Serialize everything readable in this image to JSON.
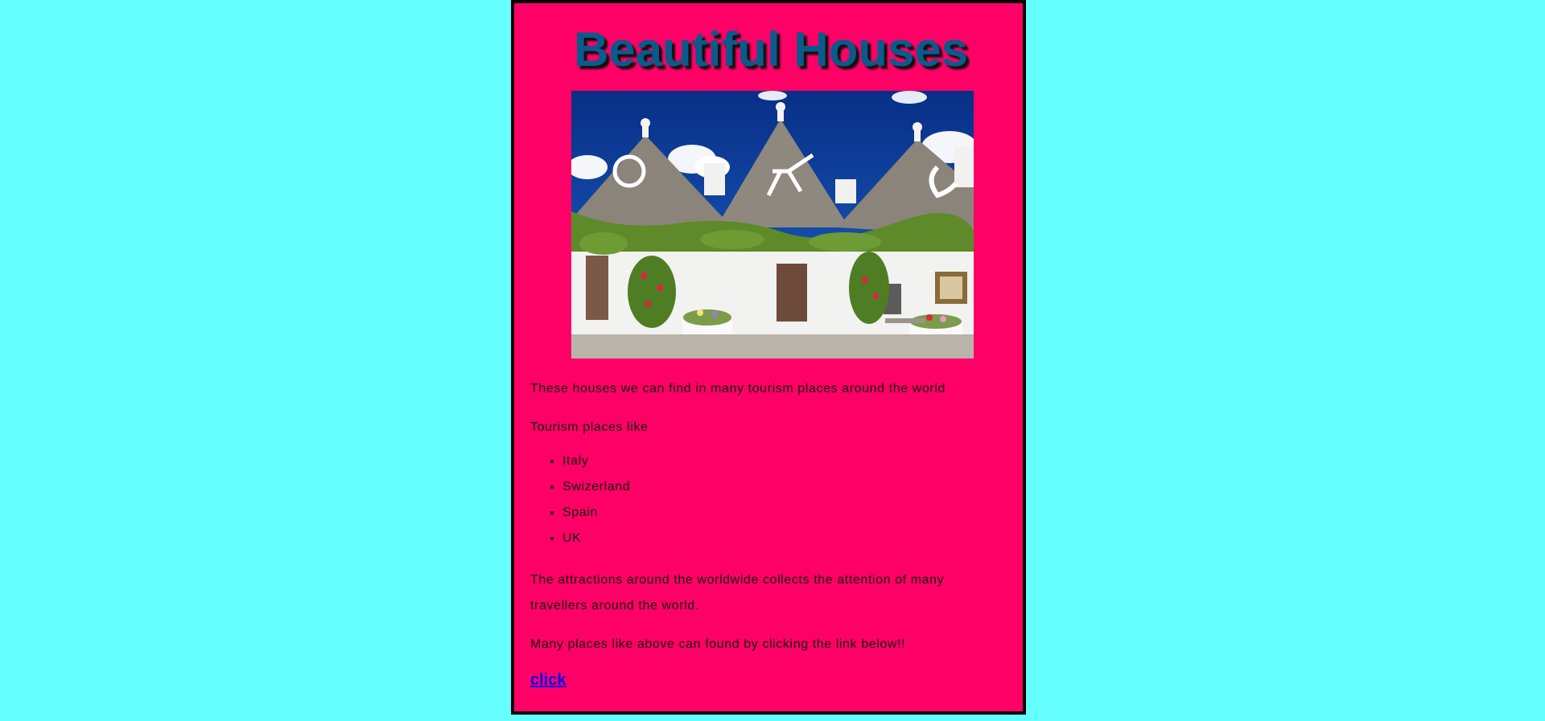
{
  "page": {
    "title": "Beautiful Houses",
    "image": {
      "subject": "trulli-houses-photo",
      "colors": {
        "sky": "#0a3f9c",
        "roof": "#8b847a",
        "walls": "#f2f2f0",
        "vines": "#5e8a2a",
        "flowers": "#d8283a",
        "ground": "#b9b3aa"
      }
    },
    "intro": "These houses we can find in many tourism places around the world",
    "list_heading": "Tourism places like",
    "places": [
      "Italy",
      "Swizerland",
      "Spain",
      "UK"
    ],
    "attractions": "The attractions around the worldwide collects the attention of many travellers around the world.",
    "cta": "Many places like above can found by clicking the link below!!",
    "link_label": "click"
  },
  "colors": {
    "background": "#66ffff",
    "card": "#ff0066",
    "title": "#0b5a8c",
    "link": "#0000ee"
  }
}
